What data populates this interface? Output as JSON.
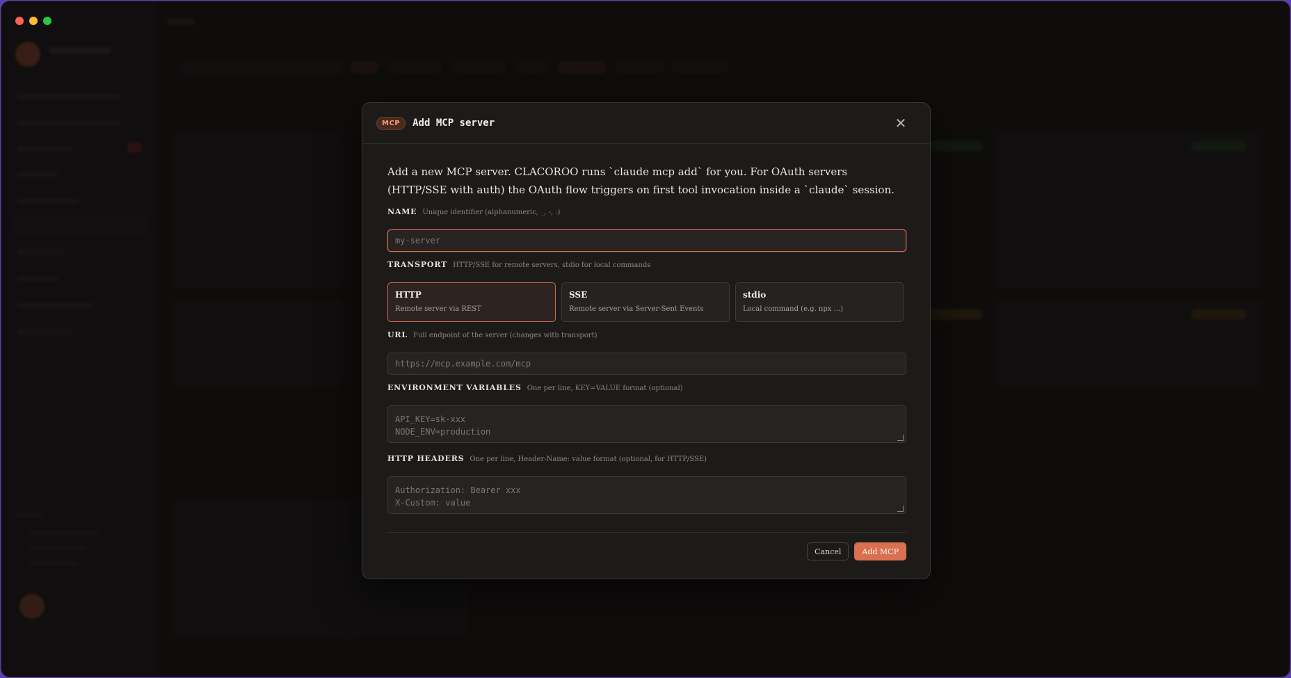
{
  "modal": {
    "badge": "MCP",
    "title": "Add MCP server",
    "intro": "Add a new MCP server. CLACOROO runs `claude mcp add` for you. For OAuth servers (HTTP/SSE with auth) the OAuth flow triggers on first tool invocation inside a `claude` session.",
    "name": {
      "label": "NAME",
      "hint": "Unique identifier (alphanumeric, _, -, .)",
      "placeholder": "my-server"
    },
    "transport": {
      "label": "TRANSPORT",
      "hint": "HTTP/SSE for remote servers, stdio for local commands",
      "options": [
        {
          "name": "HTTP",
          "desc": "Remote server via REST",
          "selected": true
        },
        {
          "name": "SSE",
          "desc": "Remote server via Server-Sent Events",
          "selected": false
        },
        {
          "name": "stdio",
          "desc": "Local command (e.g. npx ...)",
          "selected": false
        }
      ]
    },
    "url": {
      "label": "URL",
      "hint": "Full endpoint of the server (changes with transport)",
      "placeholder": "https://mcp.example.com/mcp"
    },
    "env": {
      "label": "ENVIRONMENT VARIABLES",
      "hint": "One per line, KEY=VALUE format (optional)",
      "placeholder_lines": [
        "API_KEY=sk-xxx",
        "NODE_ENV=production"
      ]
    },
    "headers": {
      "label": "HTTP HEADERS",
      "hint": "One per line, Header-Name: value format (optional, for HTTP/SSE)",
      "placeholder_lines": [
        "Authorization: Bearer xxx",
        "X-Custom: value"
      ]
    },
    "footer": {
      "cancel": "Cancel",
      "add": "Add MCP"
    }
  },
  "colors": {
    "accent": "#d9704f",
    "background": "#141312",
    "modal": "#1d1b1a"
  },
  "icons": {
    "close": "close-icon"
  }
}
